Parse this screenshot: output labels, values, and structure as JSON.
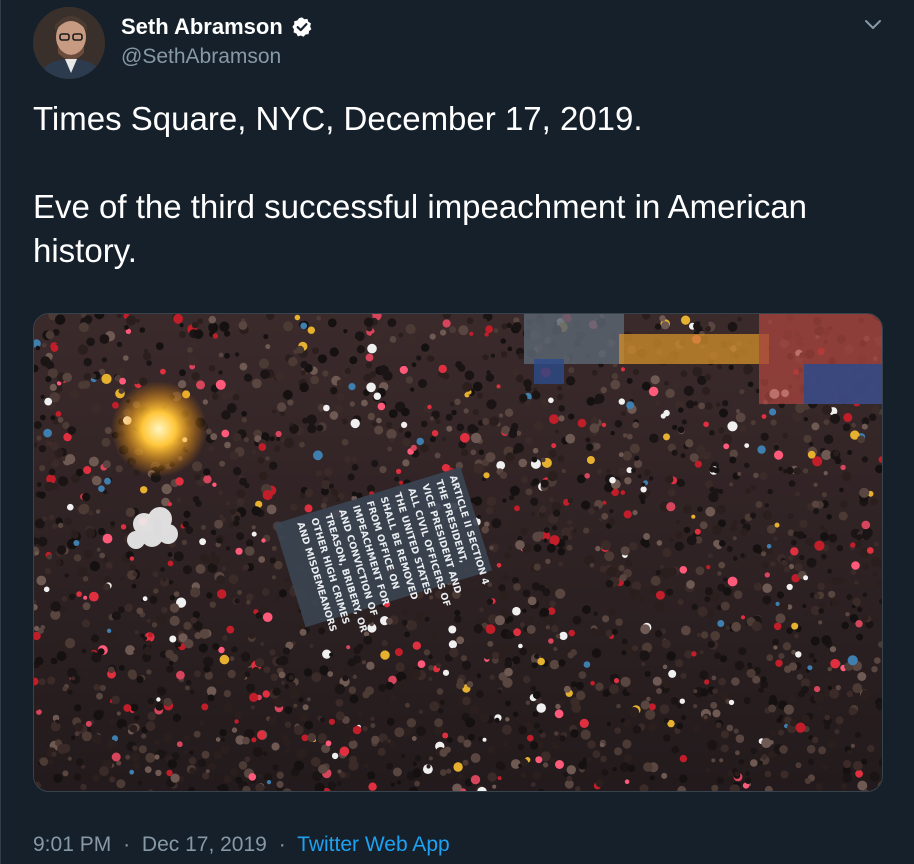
{
  "author": {
    "display_name": "Seth Abramson",
    "handle": "@SethAbramson",
    "verified": true
  },
  "tweet": {
    "paragraph_1": "Times Square, NYC, December 17, 2019.",
    "paragraph_2": "Eve of the third successful impeachment in American history."
  },
  "media": {
    "banner_lines": [
      "ARTICLE II SECTION 4",
      "THE PRESIDENT,",
      "VICE PRESIDENT AND",
      "ALL CIVIL OFFICERS OF",
      "THE UNITED STATES",
      "SHALL BE REMOVED",
      "FROM OFFICE ON",
      "IMPEACHMENT FOR",
      "AND CONVICTION OF",
      "TREASON, BRIBERY, OR",
      "OTHER HIGH CRIMES",
      "AND MISDEMEANORS"
    ]
  },
  "meta": {
    "time": "9:01 PM",
    "separator": "·",
    "date": "Dec 17, 2019",
    "source": "Twitter Web App"
  },
  "icons": {
    "verified": "verified-badge-icon",
    "menu": "chevron-down-icon"
  },
  "colors": {
    "background": "#15202b",
    "secondary_text": "#8899a6",
    "link": "#1da1f2"
  }
}
